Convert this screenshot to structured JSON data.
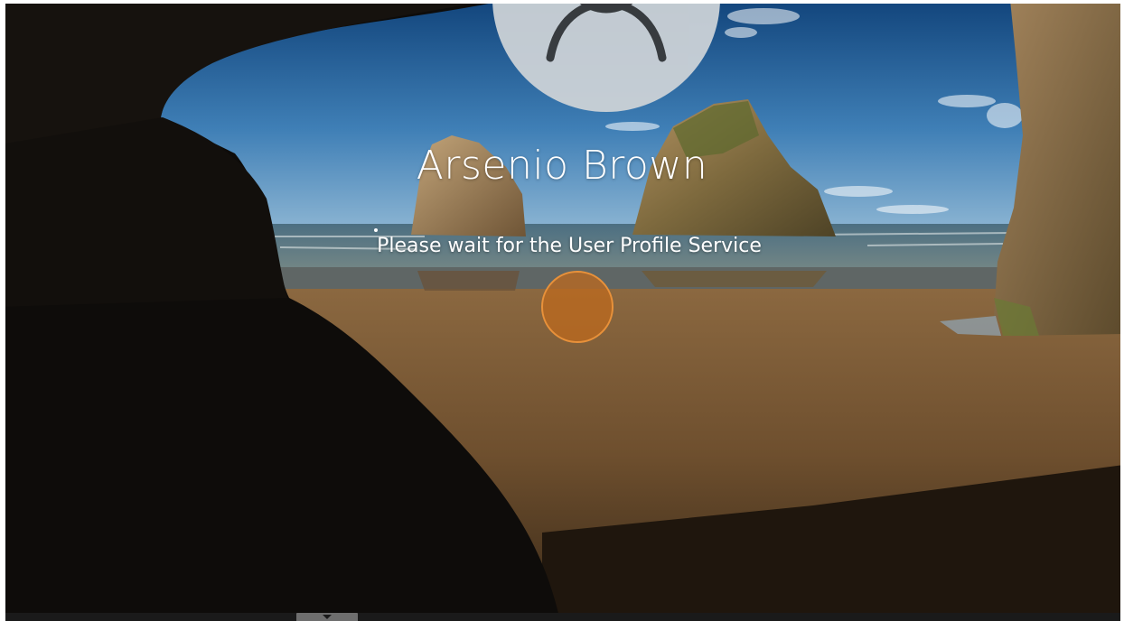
{
  "lock_screen": {
    "user_name": "Arsenio Brown",
    "status_message": "Please wait for the User Profile Service",
    "avatar_icon": "user-silhouette-icon",
    "spinner_icon": "loading-spinner-icon",
    "accent_color": "#e8913a"
  },
  "taskbar": {
    "toggle_icon": "chevron-down-icon"
  }
}
